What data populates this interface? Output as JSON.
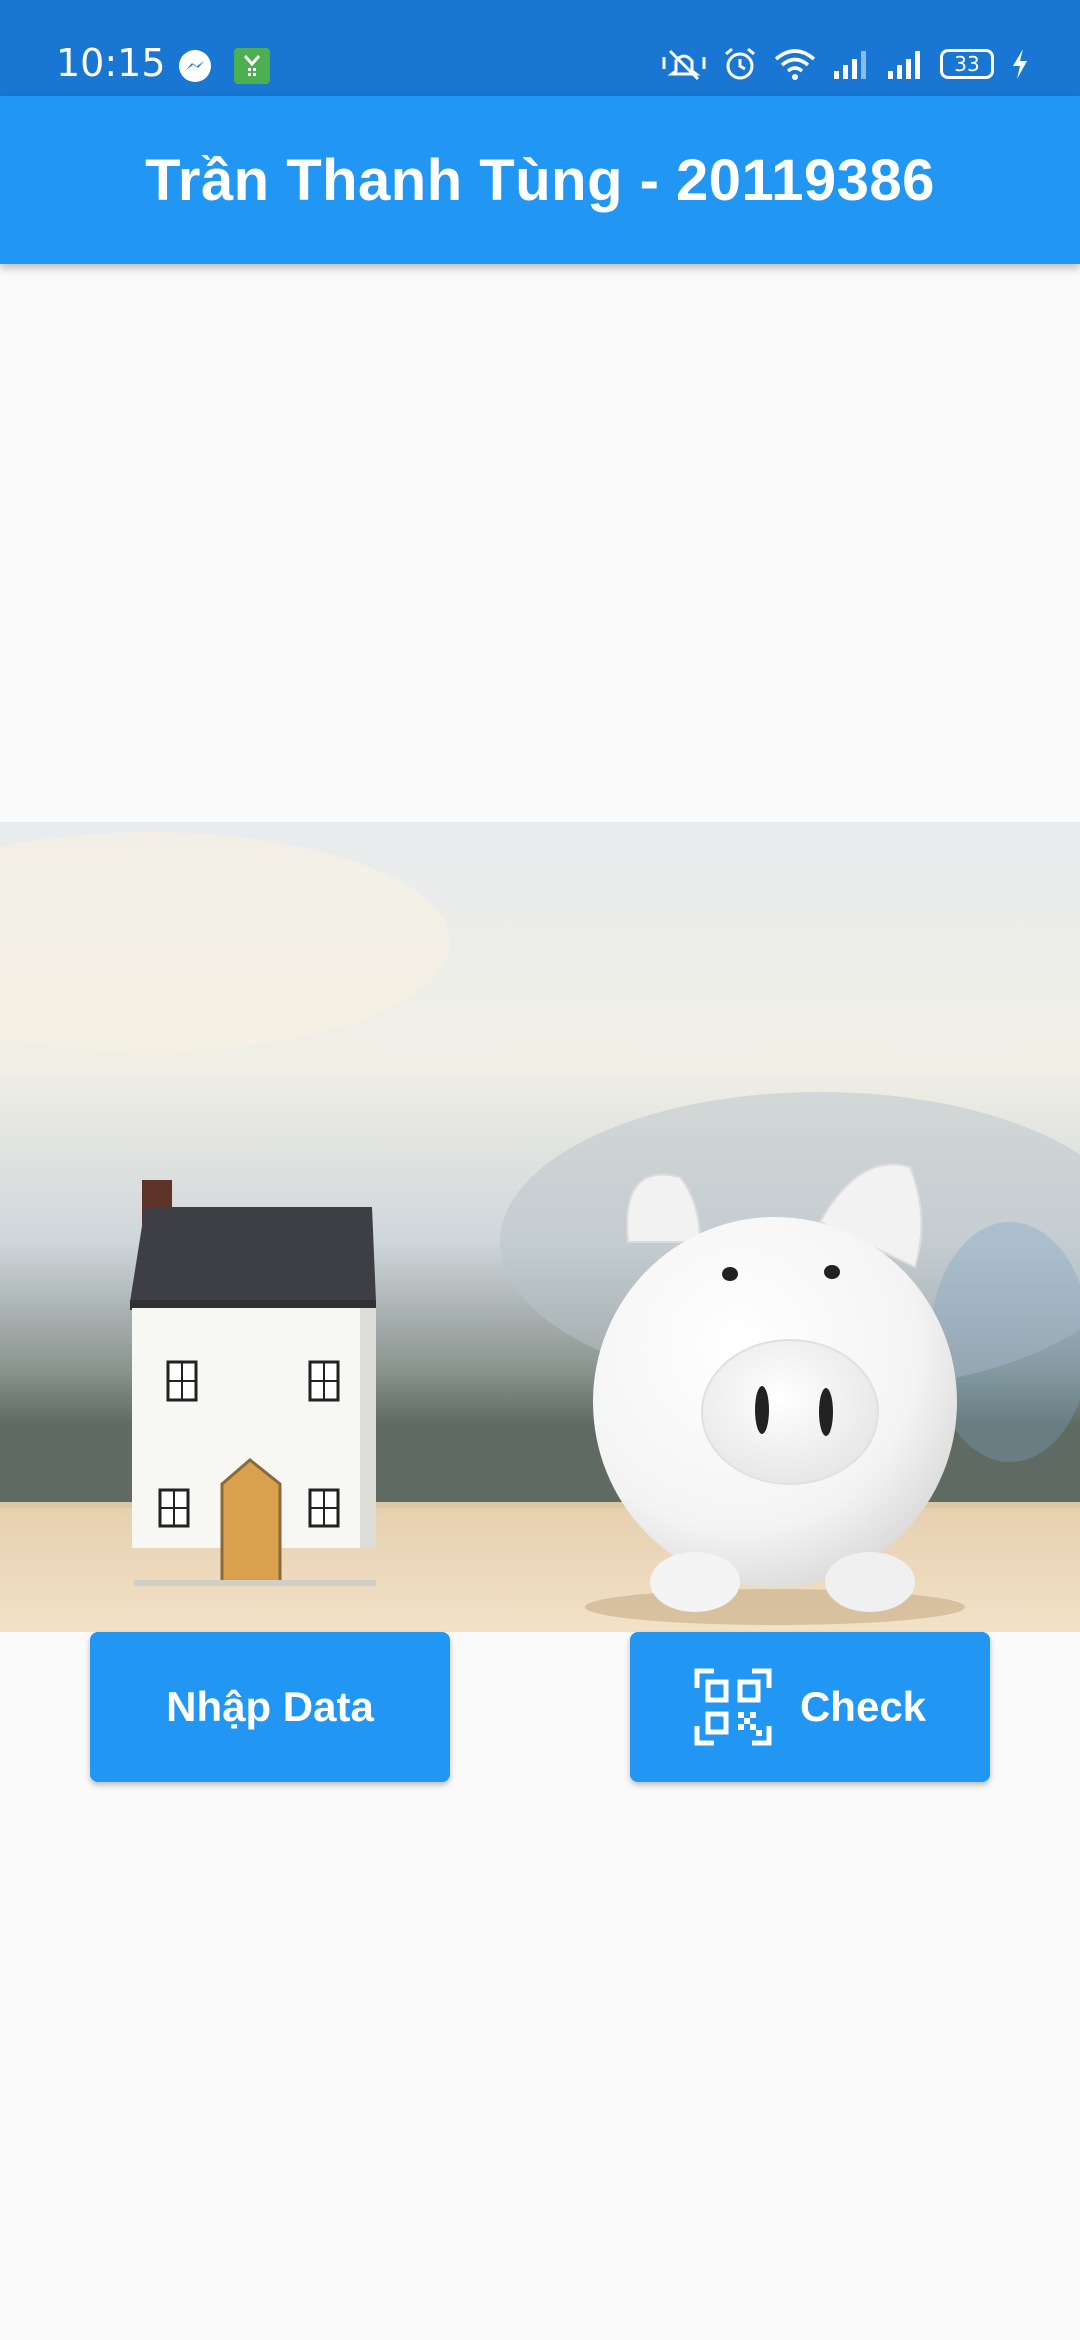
{
  "status_bar": {
    "time": "10:15",
    "left_icons": [
      "messenger-icon",
      "sim-app-icon"
    ],
    "right_icons": [
      "mute-icon",
      "alarm-icon",
      "wifi-icon",
      "signal-icon",
      "signal-icon"
    ],
    "battery_level": "33"
  },
  "app_bar": {
    "title": "Trần Thanh Tùng - 20119386"
  },
  "hero": {
    "description_icon": "house-and-piggy-bank-image"
  },
  "buttons": {
    "nhap_label": "Nhập Data",
    "check_label": "Check",
    "check_icon": "qr-code-icon"
  },
  "colors": {
    "status_bar": "#1976d2",
    "primary": "#2196f3",
    "background": "#fafafa"
  }
}
